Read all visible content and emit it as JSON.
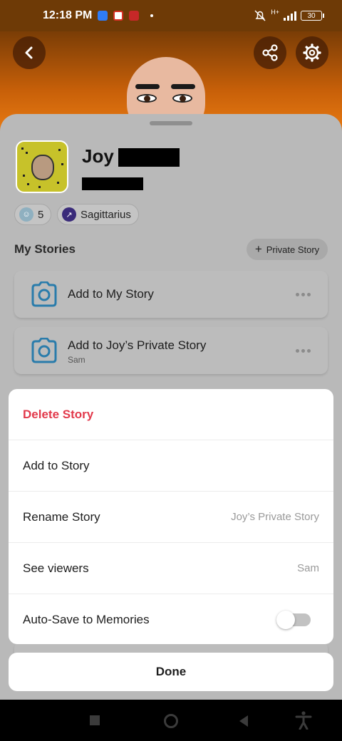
{
  "status_bar": {
    "time": "12:18 PM",
    "battery": "30",
    "network": "H+"
  },
  "header": {
    "back_icon": "chevron-left-icon",
    "share_icon": "share-icon",
    "settings_icon": "gear-icon"
  },
  "profile": {
    "name": "Joy",
    "score": "5",
    "zodiac": "Sagittarius"
  },
  "stories": {
    "section_title": "My Stories",
    "private_story_button": "Private Story",
    "items": [
      {
        "title": "Add to My Story",
        "subtitle": ""
      },
      {
        "title": "Add to Joy’s Private Story",
        "subtitle": "Sam"
      }
    ]
  },
  "action_sheet": {
    "delete": "Delete Story",
    "add": "Add to Story",
    "rename": {
      "label": "Rename Story",
      "value": "Joy’s Private Story"
    },
    "viewers": {
      "label": "See viewers",
      "value": "Sam"
    },
    "autosave": {
      "label": "Auto-Save to Memories",
      "enabled": false
    },
    "done": "Done"
  },
  "colors": {
    "accent_orange": "#c86009",
    "delete_red": "#e2394b",
    "camera_blue": "#2a9bd8",
    "snapcode_yellow": "#fffc00"
  }
}
